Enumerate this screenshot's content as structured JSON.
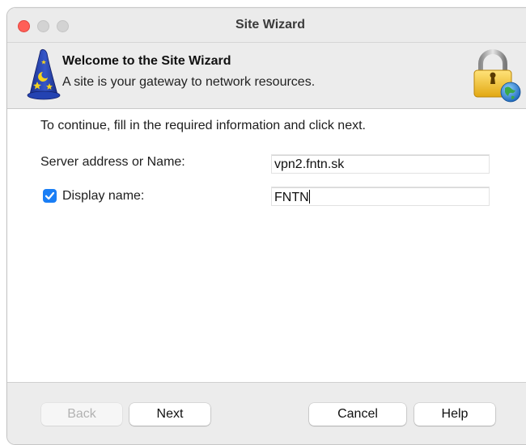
{
  "window": {
    "title": "Site Wizard"
  },
  "header": {
    "title": "Welcome to the Site Wizard",
    "subtitle": "A site is your gateway to network resources.",
    "left_icon": "wizard-hat-icon",
    "right_icon": "lock-globe-icon"
  },
  "form": {
    "instruction": "To continue, fill in the required information and click next.",
    "server_label": "Server address or Name:",
    "server_value": "vpn2.fntn.sk",
    "display_label": "Display name:",
    "display_value": "FNTN",
    "display_checked": true
  },
  "buttons": {
    "back": "Back",
    "next": "Next",
    "cancel": "Cancel",
    "help": "Help"
  },
  "colors": {
    "close_button": "#ff5f57",
    "checkbox_accent": "#1a7ef5"
  }
}
